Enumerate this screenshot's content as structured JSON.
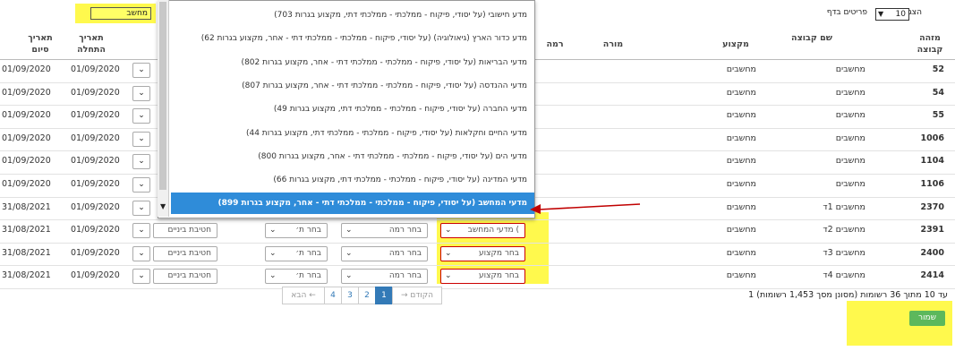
{
  "toolbar": {
    "search_value": "מחשב",
    "page_size_show": "הצג",
    "page_size_value": "10",
    "page_size_suffix": "פריטים בדף"
  },
  "columns": {
    "group_id": "מזהה קבוצה",
    "group_name": "שם קבוצה",
    "subject": "מקצוע",
    "teacher": "מורה",
    "level": "רמה",
    "start_date": "תאריך התחלה",
    "end_date": "תאריך סיום"
  },
  "rows": [
    {
      "id": "52",
      "name": "מחשבים",
      "subject": "מחשבים",
      "start": "01/09/2020",
      "end": "01/09/2020"
    },
    {
      "id": "54",
      "name": "מחשבים",
      "subject": "מחשבים",
      "start": "01/09/2020",
      "end": "01/09/2020"
    },
    {
      "id": "55",
      "name": "מחשבים",
      "subject": "מחשבים",
      "start": "01/09/2020",
      "end": "01/09/2020"
    },
    {
      "id": "1006",
      "name": "מחשבים",
      "subject": "מחשבים",
      "start": "01/09/2020",
      "end": "01/09/2020"
    },
    {
      "id": "1104",
      "name": "מחשבים",
      "subject": "מחשבים",
      "start": "01/09/2020",
      "end": "01/09/2020"
    },
    {
      "id": "1106",
      "name": "מחשבים",
      "subject": "מחשבים",
      "start": "01/09/2020",
      "end": "01/09/2020"
    },
    {
      "id": "2370",
      "name": "מחשבים 1ד",
      "subject": "מחשבים",
      "start": "01/09/2020",
      "end": "31/08/2021"
    },
    {
      "id": "2391",
      "name": "מחשבים 2ד",
      "subject": "מחשבים",
      "start": "01/09/2020",
      "end": "31/08/2021",
      "subject_select": "מדעי המחשב (",
      "teacher_select": "בחר ת׳",
      "level_select": "בחר רמה",
      "grade_select": "חטיבת ביניים"
    },
    {
      "id": "2400",
      "name": "מחשבים 3ד",
      "subject": "מחשבים",
      "start": "01/09/2020",
      "end": "31/08/2021",
      "subject_select": "בחר מקצוע",
      "teacher_select": "בחר ת׳",
      "level_select": "בחר רמה",
      "grade_select": "חטיבת ביניים"
    },
    {
      "id": "2414",
      "name": "מחשבים 4ד",
      "subject": "מחשבים",
      "start": "01/09/2020",
      "end": "31/08/2021",
      "subject_select": "בחר מקצוע",
      "teacher_select": "בחר ת׳",
      "level_select": "בחר רמה",
      "grade_select": "חטיבת ביניים"
    }
  ],
  "dropdown": {
    "items": [
      "מדע חישובי (על יסודי, פיקוח - ממלכתי - ממלכתי דתי, מקצוע בגרות 703)",
      "מדע כדור הארץ (גיאולוגיה) (על יסודי, פיקוח - ממלכתי - ממלכתי דתי - אחר, מקצוע בגרות 62)",
      "מדעי הבריאות (על יסודי, פיקוח - ממלכתי - ממלכתי דתי - אחר, מקצוע בגרות 802)",
      "מדעי ההנדסה (על יסודי, פיקוח - ממלכתי - ממלכתי דתי - אחר, מקצוע בגרות 807)",
      "מדעי החברה (על יסודי, פיקוח - ממלכתי - ממלכתי דתי, מקצוע בגרות 49)",
      "מדעי החיים וחקלאות (על יסודי, פיקוח - ממלכתי - ממלכתי דתי, מקצוע בגרות 44)",
      "מדעי הים (על יסודי, פיקוח - ממלכתי - ממלכתי דתי - אחר, מקצוע בגרות 800)",
      "מדעי המדינה (על יסודי, פיקוח - ממלכתי - ממלכתי דתי, מקצוע בגרות 66)",
      "מדעי המחשב (על יסודי, פיקוח - ממלכתי - ממלכתי דתי - אחר, מקצוע בגרות 899)"
    ]
  },
  "pagination": {
    "prev": "→ הקודם",
    "pages": [
      "1",
      "2",
      "3",
      "4"
    ],
    "next": "הבא ←"
  },
  "status_text": "1 עד 10 מתוך 36 רשומות (מסונן מסך 1,453 רשומות)",
  "save_label": "שמור",
  "colors": {
    "highlight": "#fff94d",
    "active": "#2f8cd9",
    "save": "#5cb85c",
    "arrow": "#c00000"
  }
}
